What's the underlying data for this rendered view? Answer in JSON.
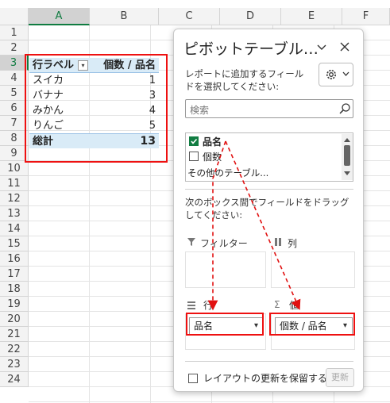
{
  "columns": [
    "A",
    "B",
    "C",
    "D",
    "E",
    "F"
  ],
  "rows": [
    "1",
    "2",
    "3",
    "4",
    "5",
    "6",
    "7",
    "8",
    "9",
    "10",
    "11",
    "12",
    "13",
    "14",
    "15",
    "16",
    "17",
    "18",
    "19",
    "20",
    "21",
    "22",
    "23",
    "24"
  ],
  "pivot": {
    "header": {
      "row_label": "行ラベル",
      "value_label": "個数 / 品名"
    },
    "items": [
      {
        "name": "スイカ",
        "count": "1"
      },
      {
        "name": "バナナ",
        "count": "3"
      },
      {
        "name": "みかん",
        "count": "4"
      },
      {
        "name": "りんご",
        "count": "5"
      }
    ],
    "total": {
      "label": "総計",
      "count": "13"
    }
  },
  "panel": {
    "title": "ピボットテーブル…",
    "instruction": "レポートに追加するフィールドを選択してください:",
    "search_placeholder": "検索",
    "fields": [
      {
        "label": "品名",
        "checked": true
      },
      {
        "label": "個数",
        "checked": false
      }
    ],
    "more_tables": "その他のテーブル...",
    "drag_instruction": "次のボックス間でフィールドをドラッグしてください:",
    "areas": {
      "filter": "フィルター",
      "columns": "列",
      "rows": "行",
      "values": "値"
    },
    "row_field": "品名",
    "value_field": "個数 / 品名",
    "defer_update": "レイアウトの更新を保留する",
    "update_button": "更新"
  },
  "colors": {
    "accent": "#107c41",
    "highlight": "#e11111",
    "pivot_fill": "#d9ebf7"
  }
}
